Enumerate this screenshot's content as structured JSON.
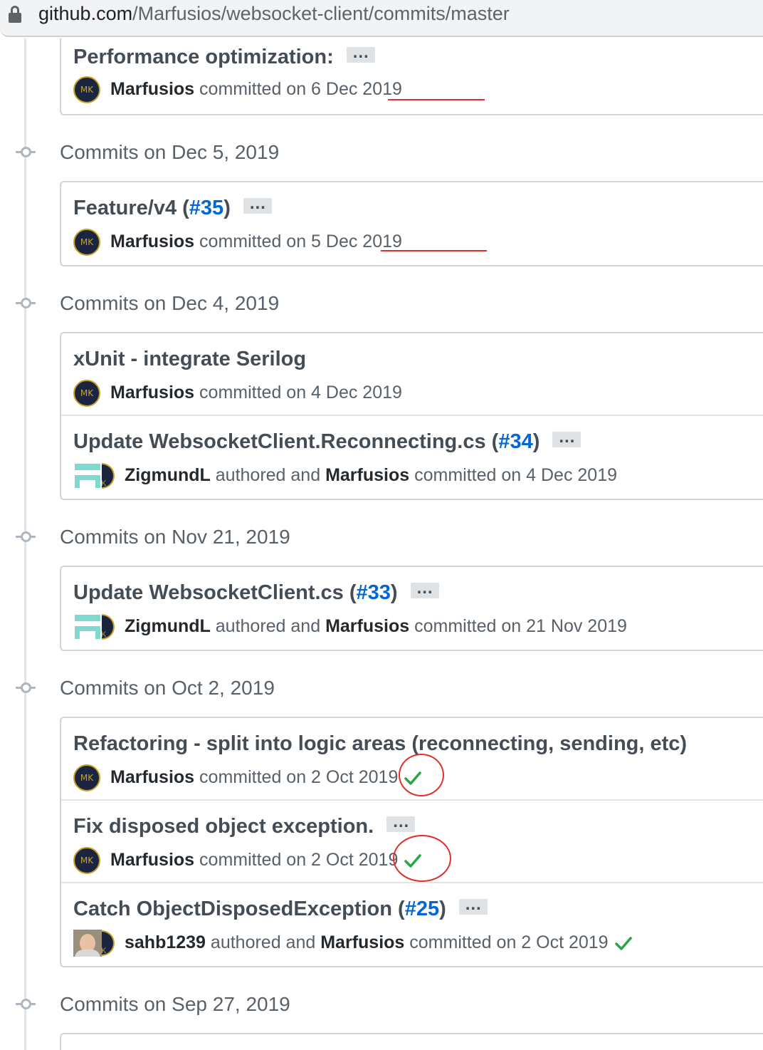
{
  "browser": {
    "url_host": "github.com",
    "url_path": "/Marfusios/websocket-client/commits/master"
  },
  "groups": [
    {
      "header": "",
      "commits": [
        {
          "title": "Performance optimization:",
          "pr": "",
          "title_suffix": "",
          "has_ellipsis": true,
          "author": "",
          "authored_text": "",
          "committer": "Marfusios",
          "committed_text": "committed on 6 Dec 2019",
          "check": false
        }
      ]
    },
    {
      "header": "Commits on Dec 5, 2019",
      "commits": [
        {
          "title": "Feature/v4 (",
          "pr": "#35",
          "title_suffix": ")",
          "has_ellipsis": true,
          "author": "",
          "authored_text": "",
          "committer": "Marfusios",
          "committed_text": "committed on 5 Dec 2019",
          "check": false
        }
      ]
    },
    {
      "header": "Commits on Dec 4, 2019",
      "commits": [
        {
          "title": "xUnit - integrate Serilog",
          "pr": "",
          "title_suffix": "",
          "has_ellipsis": false,
          "author": "",
          "authored_text": "",
          "committer": "Marfusios",
          "committed_text": "committed on 4 Dec 2019",
          "check": false
        },
        {
          "title": "Update WebsocketClient.Reconnecting.cs (",
          "pr": "#34",
          "title_suffix": ")",
          "has_ellipsis": true,
          "author": "ZigmundL",
          "authored_text": "authored and",
          "committer": "Marfusios",
          "committed_text": "committed on 4 Dec 2019",
          "check": false
        }
      ]
    },
    {
      "header": "Commits on Nov 21, 2019",
      "commits": [
        {
          "title": "Update WebsocketClient.cs (",
          "pr": "#33",
          "title_suffix": ")",
          "has_ellipsis": true,
          "author": "ZigmundL",
          "authored_text": "authored and",
          "committer": "Marfusios",
          "committed_text": "committed on 21 Nov 2019",
          "check": false
        }
      ]
    },
    {
      "header": "Commits on Oct 2, 2019",
      "commits": [
        {
          "title": "Refactoring - split into logic areas (reconnecting, sending, etc)",
          "pr": "",
          "title_suffix": "",
          "has_ellipsis": false,
          "author": "",
          "authored_text": "",
          "committer": "Marfusios",
          "committed_text": "committed on 2 Oct 2019",
          "check": true
        },
        {
          "title": "Fix disposed object exception.",
          "pr": "",
          "title_suffix": "",
          "has_ellipsis": true,
          "author": "",
          "authored_text": "",
          "committer": "Marfusios",
          "committed_text": "committed on 2 Oct 2019",
          "check": true
        },
        {
          "title": "Catch ObjectDisposedException (",
          "pr": "#25",
          "title_suffix": ")",
          "has_ellipsis": true,
          "author": "sahb1239",
          "authored_text": "authored and",
          "committer": "Marfusios",
          "committed_text": "committed on 2 Oct 2019",
          "check": true
        }
      ]
    },
    {
      "header": "Commits on Sep 27, 2019",
      "commits": []
    }
  ],
  "avatar_initials": "MK",
  "avatar_initial_short": "K",
  "ellipsis_label": "…",
  "colors": {
    "link": "#0366d6",
    "success": "#28a745",
    "annotation": "#e0302c"
  },
  "icons": [
    "lock-icon",
    "commit-node-icon",
    "check-icon",
    "ellipsis-icon"
  ]
}
